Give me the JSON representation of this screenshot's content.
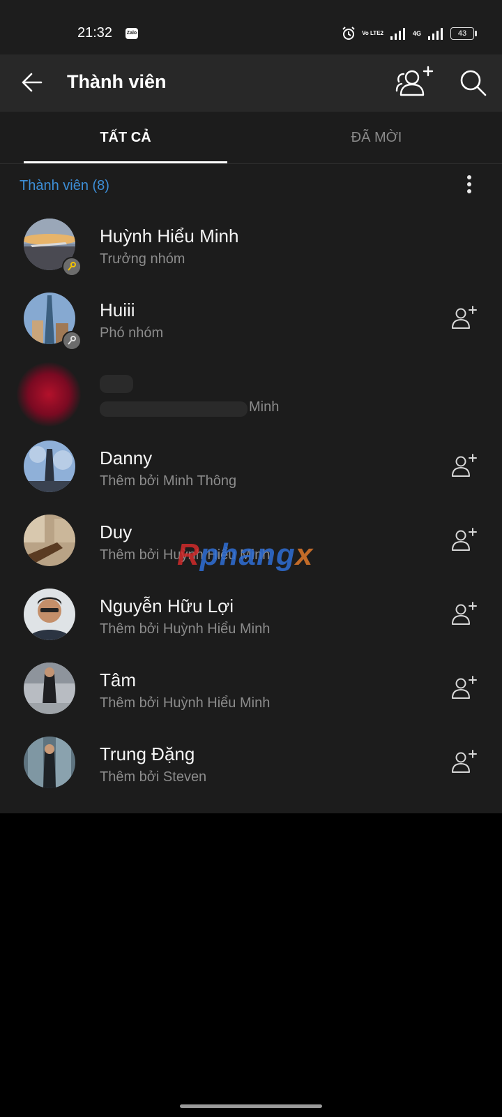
{
  "status_bar": {
    "time": "21:32",
    "zalo_badge": "Zalo",
    "volte": "Vo LTE2",
    "network": "4G",
    "battery": "43"
  },
  "header": {
    "title": "Thành viên"
  },
  "tabs": [
    {
      "label": "TẤT CẢ",
      "active": true
    },
    {
      "label": "ĐÃ MỜI",
      "active": false
    }
  ],
  "section": {
    "title": "Thành viên (8)"
  },
  "members": [
    {
      "name": "Huỳnh Hiểu Minh",
      "subtitle": "Trưởng nhóm",
      "role_badge": "key-icon",
      "add_friend": false
    },
    {
      "name": "Huiii",
      "subtitle": "Phó nhóm",
      "role_badge": "key-icon",
      "add_friend": true
    },
    {
      "name": "",
      "subtitle": "Minh",
      "blurred": true,
      "add_friend": false
    },
    {
      "name": "Danny",
      "subtitle": "Thêm bởi Minh Thông",
      "add_friend": true
    },
    {
      "name": "Duy",
      "subtitle": "Thêm bởi Huỳnh Hiểu Minh",
      "add_friend": true
    },
    {
      "name": "Nguyễn Hữu Lợi",
      "subtitle": "Thêm bởi Huỳnh Hiểu Minh",
      "add_friend": true
    },
    {
      "name": "Tâm",
      "subtitle": "Thêm bởi Huỳnh Hiểu Minh",
      "add_friend": true
    },
    {
      "name": "Trung Đặng",
      "subtitle": "Thêm bởi Steven",
      "add_friend": true
    }
  ],
  "watermark": {
    "part1": "R",
    "part2": "phang",
    "part3": "x"
  },
  "colors": {
    "accent": "#3d8fd8",
    "background": "#1c1c1c",
    "header": "#282828"
  }
}
